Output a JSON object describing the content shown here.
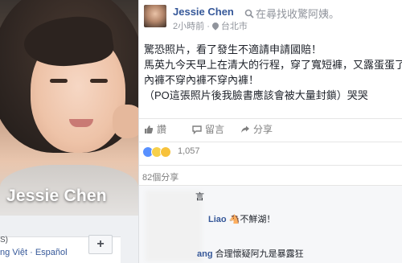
{
  "profile": {
    "name": "Jessie Chen",
    "language_top": "S)",
    "language_links": "ng Việt · Español",
    "add_button": "+"
  },
  "post": {
    "author": "Jessie Chen",
    "activity": "在尋找收驚阿姨。",
    "time": "2小時前",
    "location": "台北市",
    "lines": [
      "驚恐照片，看了發生不適請申請國賠！",
      "馬英九今天早上在清大的行程，穿了寬短褲，又露蛋蛋了",
      "內褲不穿內褲不穿內褲！",
      "（PO這張照片後我臉書應該會被大量封鎖）哭哭"
    ],
    "actions": {
      "like": "讚",
      "comment": "留言",
      "share": "分享"
    },
    "reaction_count": "1,057",
    "share_count": "82個分享"
  },
  "comments": [
    {
      "name": "",
      "text": "言"
    },
    {
      "name": "Liao",
      "text": "🐴不鮮湖！"
    },
    {
      "name": "ang",
      "text": "合理懷疑阿九是暴露狂"
    }
  ],
  "colors": {
    "link": "#365899",
    "meta": "#90949c",
    "text": "#1d2129",
    "like_blue": "#5890ff"
  }
}
